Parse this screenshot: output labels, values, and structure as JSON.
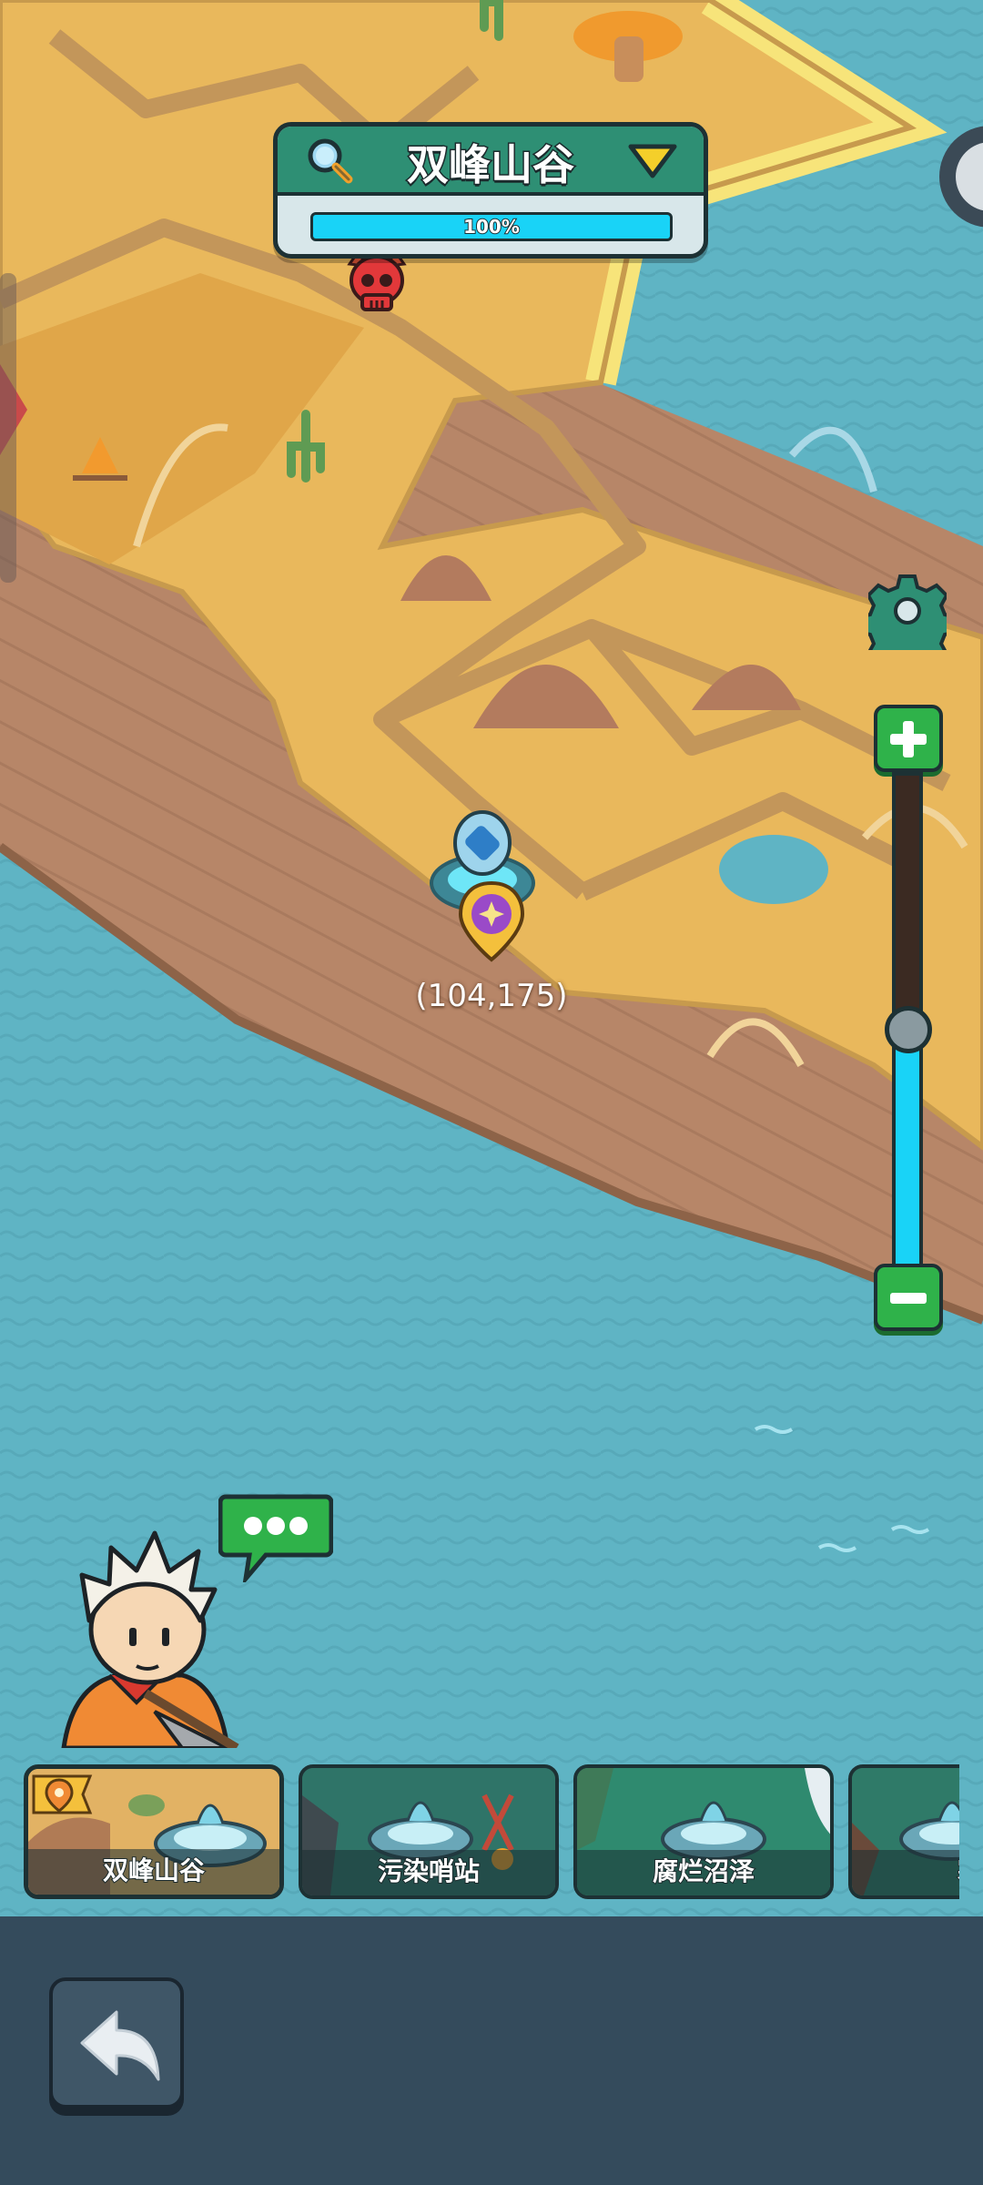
{
  "region_header": {
    "title": "双峰山谷",
    "progress": 1.0,
    "progress_label": "100%"
  },
  "map": {
    "coordinates": "(104,175)",
    "zoom_level": 0.48
  },
  "region_strip": {
    "items": [
      {
        "label": "双峰山谷",
        "selected": true
      },
      {
        "label": "污染哨站",
        "selected": false
      },
      {
        "label": "腐烂沼泽",
        "selected": false
      },
      {
        "label": "寒",
        "selected": false
      }
    ]
  },
  "colors": {
    "sea": "#5fb4c4",
    "sand": "#e9b85c",
    "dirt": "#b78668",
    "header_green": "#2e8f74",
    "progress_cyan": "#19d3f7",
    "button_green": "#2fb24a",
    "bottom_bar": "#344b5c"
  },
  "icons": {
    "search": "magnifier-icon",
    "dropdown": "triangle-down-icon",
    "settings": "gear-icon",
    "zoom_in": "plus-icon",
    "zoom_out": "minus-icon",
    "back": "back-arrow-icon",
    "chat": "speech-bubble-icon",
    "boss": "skull-icon",
    "player": "map-pin-icon"
  }
}
